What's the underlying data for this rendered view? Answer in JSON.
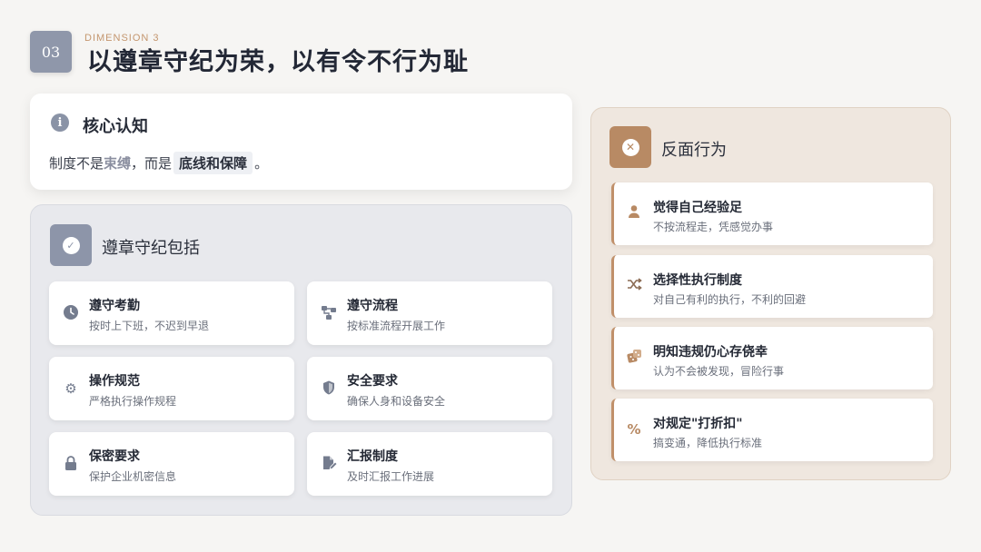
{
  "header": {
    "number": "03",
    "eyebrow": "DIMENSION 3",
    "title": "以遵章守纪为荣，以有令不行为耻"
  },
  "core": {
    "icon": "info-icon",
    "title": "核心认知",
    "text_prefix": "制度不是",
    "keyword1": "束缚",
    "text_middle": "，而是",
    "keyword2": "底线和保障",
    "text_suffix": "。"
  },
  "compliance": {
    "icon": "check-circle-icon",
    "title": "遵章守纪包括",
    "items": [
      {
        "icon": "clock-icon",
        "title": "遵守考勤",
        "desc": "按时上下班，不迟到早退"
      },
      {
        "icon": "flow-icon",
        "title": "遵守流程",
        "desc": "按标准流程开展工作"
      },
      {
        "icon": "gears-icon",
        "title": "操作规范",
        "desc": "严格执行操作规程"
      },
      {
        "icon": "shield-icon",
        "title": "安全要求",
        "desc": "确保人身和设备安全"
      },
      {
        "icon": "lock-icon",
        "title": "保密要求",
        "desc": "保护企业机密信息"
      },
      {
        "icon": "file-edit-icon",
        "title": "汇报制度",
        "desc": "及时汇报工作进展"
      }
    ]
  },
  "negative": {
    "icon": "close-circle-icon",
    "title": "反面行为",
    "items": [
      {
        "icon": "user-icon",
        "title": "觉得自己经验足",
        "desc": "不按流程走，凭感觉办事"
      },
      {
        "icon": "shuffle-icon",
        "title": "选择性执行制度",
        "desc": "对自己有利的执行，不利的回避"
      },
      {
        "icon": "dice-icon",
        "title": "明知违规仍心存侥幸",
        "desc": "认为不会被发现，冒险行事"
      },
      {
        "icon": "percent-icon",
        "title": "对规定\"打折扣\"",
        "desc": "搞变通，降低执行标准"
      }
    ]
  },
  "colors": {
    "background": "#f6f5f3",
    "slate": "#8d95a9",
    "accent_brown": "#b88a64",
    "eyebrow": "#c4966e"
  }
}
